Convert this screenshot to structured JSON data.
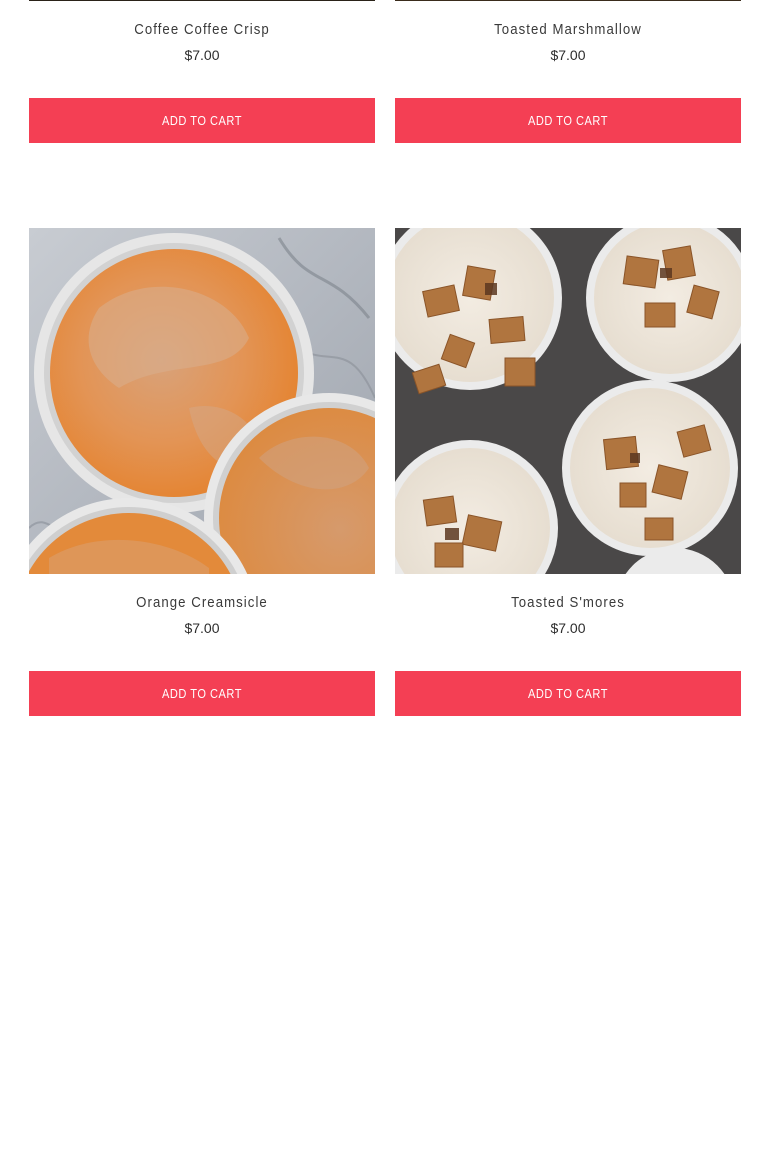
{
  "products": [
    {
      "name": "Coffee Coffee Crisp",
      "price": "$7.00",
      "button": "ADD TO CART"
    },
    {
      "name": "Toasted Marshmallow",
      "price": "$7.00",
      "button": "ADD TO CART"
    },
    {
      "name": "Orange Creamsicle",
      "price": "$7.00",
      "button": "ADD TO CART",
      "image": "orange-creamsicle-photo"
    },
    {
      "name": "Toasted S'mores",
      "price": "$7.00",
      "button": "ADD TO CART",
      "image": "toasted-smores-photo"
    }
  ],
  "colors": {
    "button_bg": "#f43f54",
    "button_text": "#ffffff",
    "background": "#ffffff"
  }
}
